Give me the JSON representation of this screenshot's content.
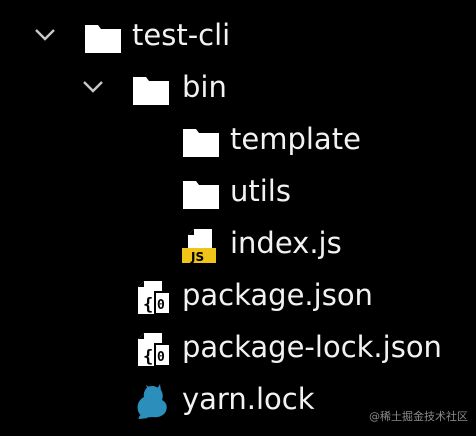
{
  "explorer": {
    "items": [
      {
        "label": "test-cli",
        "type": "folder",
        "expanded": true,
        "depth": 0
      },
      {
        "label": "bin",
        "type": "folder",
        "expanded": true,
        "depth": 1
      },
      {
        "label": "template",
        "type": "folder",
        "depth": 2
      },
      {
        "label": "utils",
        "type": "folder",
        "depth": 2
      },
      {
        "label": "index.js",
        "type": "js-file",
        "badge": "JS",
        "depth": 2
      },
      {
        "label": "package.json",
        "type": "npm-json-file",
        "depth": 1
      },
      {
        "label": "package-lock.json",
        "type": "npm-json-file",
        "depth": 1
      },
      {
        "label": "yarn.lock",
        "type": "yarn-file",
        "depth": 1
      }
    ]
  },
  "colors": {
    "background": "#000000",
    "text": "#f2f2f2",
    "folder": "#ffffff",
    "js_badge": "#f0c419",
    "yarn": "#2c8ebb",
    "chevron": "#c8c8c8"
  },
  "icons": {
    "chevron": "chevron-down-icon",
    "folder": "folder-icon",
    "js_file": "js-file-icon",
    "npm_json": "npm-json-icon",
    "yarn": "yarn-cat-icon"
  },
  "watermark": "@稀土掘金技术社区"
}
